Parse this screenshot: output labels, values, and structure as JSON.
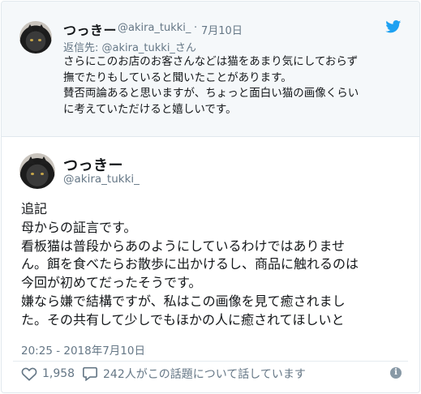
{
  "colors": {
    "accent": "#1da1f2",
    "muted": "#657786",
    "reply_bg": "#f5f8fa",
    "border": "#e1e8ed"
  },
  "reply_tweet": {
    "author_name": "つっきー",
    "handle": "@akira_tukki_",
    "separator": "·",
    "date": "7月10日",
    "replying_to": "返信先: @akira_tukki_さん",
    "body": "さらにこのお店のお客さんなどは猫をあまり気にしておらず\n撫でたりもしていると聞いたことがあります。\n賛否両論あると思いますが、ちょっと面白い猫の画像くらい\nに考えていただけると嬉しいです。",
    "icons": {
      "brand": "twitter-bird-icon"
    }
  },
  "main_tweet": {
    "author_name": "つっきー",
    "handle": "@akira_tukki_",
    "body": "追記\n母からの証言です。\n看板猫は普段からあのようにしているわけではありませ\nん。餌を食べたらお散歩に出かけるし、商品に触れるのは\n今回が初めてだったそうです。\n嫌なら嫌で結構ですが、私はこの画像を見て癒されまし\nた。その共有して少しでもほかの人に癒されてほしいと",
    "timestamp": "20:25 - 2018年7月10日",
    "likes": "1,958",
    "conversation": "242人がこの話題について話しています",
    "icons": {
      "like": "heart-icon",
      "comment": "comment-icon",
      "info": "info-icon"
    }
  }
}
